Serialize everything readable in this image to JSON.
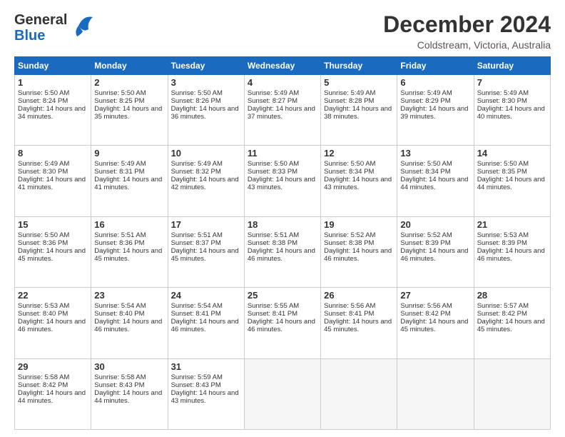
{
  "logo": {
    "general": "General",
    "blue": "Blue"
  },
  "title": "December 2024",
  "location": "Coldstream, Victoria, Australia",
  "days": [
    "Sunday",
    "Monday",
    "Tuesday",
    "Wednesday",
    "Thursday",
    "Friday",
    "Saturday"
  ],
  "weeks": [
    [
      {
        "day": 1,
        "sunrise": "Sunrise: 5:50 AM",
        "sunset": "Sunset: 8:24 PM",
        "daylight": "Daylight: 14 hours and 34 minutes."
      },
      {
        "day": 2,
        "sunrise": "Sunrise: 5:50 AM",
        "sunset": "Sunset: 8:25 PM",
        "daylight": "Daylight: 14 hours and 35 minutes."
      },
      {
        "day": 3,
        "sunrise": "Sunrise: 5:50 AM",
        "sunset": "Sunset: 8:26 PM",
        "daylight": "Daylight: 14 hours and 36 minutes."
      },
      {
        "day": 4,
        "sunrise": "Sunrise: 5:49 AM",
        "sunset": "Sunset: 8:27 PM",
        "daylight": "Daylight: 14 hours and 37 minutes."
      },
      {
        "day": 5,
        "sunrise": "Sunrise: 5:49 AM",
        "sunset": "Sunset: 8:28 PM",
        "daylight": "Daylight: 14 hours and 38 minutes."
      },
      {
        "day": 6,
        "sunrise": "Sunrise: 5:49 AM",
        "sunset": "Sunset: 8:29 PM",
        "daylight": "Daylight: 14 hours and 39 minutes."
      },
      {
        "day": 7,
        "sunrise": "Sunrise: 5:49 AM",
        "sunset": "Sunset: 8:30 PM",
        "daylight": "Daylight: 14 hours and 40 minutes."
      }
    ],
    [
      {
        "day": 8,
        "sunrise": "Sunrise: 5:49 AM",
        "sunset": "Sunset: 8:30 PM",
        "daylight": "Daylight: 14 hours and 41 minutes."
      },
      {
        "day": 9,
        "sunrise": "Sunrise: 5:49 AM",
        "sunset": "Sunset: 8:31 PM",
        "daylight": "Daylight: 14 hours and 41 minutes."
      },
      {
        "day": 10,
        "sunrise": "Sunrise: 5:49 AM",
        "sunset": "Sunset: 8:32 PM",
        "daylight": "Daylight: 14 hours and 42 minutes."
      },
      {
        "day": 11,
        "sunrise": "Sunrise: 5:50 AM",
        "sunset": "Sunset: 8:33 PM",
        "daylight": "Daylight: 14 hours and 43 minutes."
      },
      {
        "day": 12,
        "sunrise": "Sunrise: 5:50 AM",
        "sunset": "Sunset: 8:34 PM",
        "daylight": "Daylight: 14 hours and 43 minutes."
      },
      {
        "day": 13,
        "sunrise": "Sunrise: 5:50 AM",
        "sunset": "Sunset: 8:34 PM",
        "daylight": "Daylight: 14 hours and 44 minutes."
      },
      {
        "day": 14,
        "sunrise": "Sunrise: 5:50 AM",
        "sunset": "Sunset: 8:35 PM",
        "daylight": "Daylight: 14 hours and 44 minutes."
      }
    ],
    [
      {
        "day": 15,
        "sunrise": "Sunrise: 5:50 AM",
        "sunset": "Sunset: 8:36 PM",
        "daylight": "Daylight: 14 hours and 45 minutes."
      },
      {
        "day": 16,
        "sunrise": "Sunrise: 5:51 AM",
        "sunset": "Sunset: 8:36 PM",
        "daylight": "Daylight: 14 hours and 45 minutes."
      },
      {
        "day": 17,
        "sunrise": "Sunrise: 5:51 AM",
        "sunset": "Sunset: 8:37 PM",
        "daylight": "Daylight: 14 hours and 45 minutes."
      },
      {
        "day": 18,
        "sunrise": "Sunrise: 5:51 AM",
        "sunset": "Sunset: 8:38 PM",
        "daylight": "Daylight: 14 hours and 46 minutes."
      },
      {
        "day": 19,
        "sunrise": "Sunrise: 5:52 AM",
        "sunset": "Sunset: 8:38 PM",
        "daylight": "Daylight: 14 hours and 46 minutes."
      },
      {
        "day": 20,
        "sunrise": "Sunrise: 5:52 AM",
        "sunset": "Sunset: 8:39 PM",
        "daylight": "Daylight: 14 hours and 46 minutes."
      },
      {
        "day": 21,
        "sunrise": "Sunrise: 5:53 AM",
        "sunset": "Sunset: 8:39 PM",
        "daylight": "Daylight: 14 hours and 46 minutes."
      }
    ],
    [
      {
        "day": 22,
        "sunrise": "Sunrise: 5:53 AM",
        "sunset": "Sunset: 8:40 PM",
        "daylight": "Daylight: 14 hours and 46 minutes."
      },
      {
        "day": 23,
        "sunrise": "Sunrise: 5:54 AM",
        "sunset": "Sunset: 8:40 PM",
        "daylight": "Daylight: 14 hours and 46 minutes."
      },
      {
        "day": 24,
        "sunrise": "Sunrise: 5:54 AM",
        "sunset": "Sunset: 8:41 PM",
        "daylight": "Daylight: 14 hours and 46 minutes."
      },
      {
        "day": 25,
        "sunrise": "Sunrise: 5:55 AM",
        "sunset": "Sunset: 8:41 PM",
        "daylight": "Daylight: 14 hours and 46 minutes."
      },
      {
        "day": 26,
        "sunrise": "Sunrise: 5:56 AM",
        "sunset": "Sunset: 8:41 PM",
        "daylight": "Daylight: 14 hours and 45 minutes."
      },
      {
        "day": 27,
        "sunrise": "Sunrise: 5:56 AM",
        "sunset": "Sunset: 8:42 PM",
        "daylight": "Daylight: 14 hours and 45 minutes."
      },
      {
        "day": 28,
        "sunrise": "Sunrise: 5:57 AM",
        "sunset": "Sunset: 8:42 PM",
        "daylight": "Daylight: 14 hours and 45 minutes."
      }
    ],
    [
      {
        "day": 29,
        "sunrise": "Sunrise: 5:58 AM",
        "sunset": "Sunset: 8:42 PM",
        "daylight": "Daylight: 14 hours and 44 minutes."
      },
      {
        "day": 30,
        "sunrise": "Sunrise: 5:58 AM",
        "sunset": "Sunset: 8:43 PM",
        "daylight": "Daylight: 14 hours and 44 minutes."
      },
      {
        "day": 31,
        "sunrise": "Sunrise: 5:59 AM",
        "sunset": "Sunset: 8:43 PM",
        "daylight": "Daylight: 14 hours and 43 minutes."
      },
      null,
      null,
      null,
      null
    ]
  ]
}
